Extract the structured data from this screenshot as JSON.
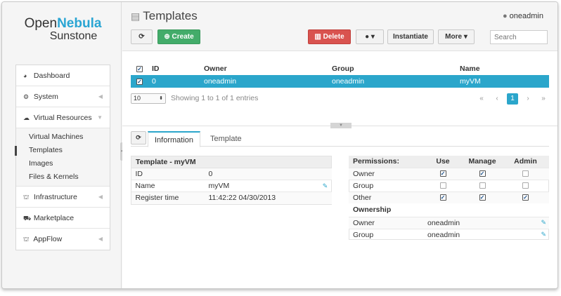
{
  "logo": {
    "brand_a": "Open",
    "brand_b": "Nebula",
    "product": "Sunstone"
  },
  "sidebar": {
    "items": [
      {
        "label": "Dashboard",
        "icon": "dashboard-icon"
      },
      {
        "label": "System",
        "icon": "gears-icon"
      },
      {
        "label": "Virtual Resources",
        "icon": "cloud-icon"
      },
      {
        "label": "Infrastructure",
        "icon": "sitemap-icon"
      },
      {
        "label": "Marketplace",
        "icon": "cart-icon"
      },
      {
        "label": "AppFlow",
        "icon": "sitemap-icon"
      }
    ],
    "subitems": [
      "Virtual Machines",
      "Templates",
      "Images",
      "Files & Kernels"
    ],
    "active_subitem": "Templates"
  },
  "header": {
    "title": "Templates",
    "user": "oneadmin",
    "buttons": {
      "create": "Create",
      "delete": "Delete",
      "instantiate": "Instantiate",
      "more": "More"
    },
    "search_placeholder": "Search"
  },
  "table": {
    "columns": [
      "ID",
      "Owner",
      "Group",
      "Name"
    ],
    "rows": [
      {
        "id": "0",
        "owner": "oneadmin",
        "group": "oneadmin",
        "name": "myVM",
        "selected": true
      }
    ],
    "page_size": "10",
    "entries_text": "Showing 1 to 1 of 1 entries",
    "current_page": "1"
  },
  "detail": {
    "tabs": [
      "Information",
      "Template"
    ],
    "active_tab": "Information",
    "info_title": "Template - myVM",
    "info_rows": [
      {
        "label": "ID",
        "value": "0"
      },
      {
        "label": "Name",
        "value": "myVM"
      },
      {
        "label": "Register time",
        "value": "11:42:22 04/30/2013"
      }
    ],
    "permissions": {
      "title": "Permissions:",
      "columns": [
        "Use",
        "Manage",
        "Admin"
      ],
      "rows": [
        {
          "label": "Owner",
          "use": true,
          "manage": true,
          "admin": false
        },
        {
          "label": "Group",
          "use": false,
          "manage": false,
          "admin": false
        },
        {
          "label": "Other",
          "use": true,
          "manage": true,
          "admin": true
        }
      ]
    },
    "ownership": {
      "title": "Ownership",
      "rows": [
        {
          "label": "Owner",
          "value": "oneadmin"
        },
        {
          "label": "Group",
          "value": "oneadmin"
        }
      ]
    }
  },
  "colors": {
    "accent": "#2ba6cb",
    "create": "#43ac6a",
    "delete": "#d9534f"
  }
}
